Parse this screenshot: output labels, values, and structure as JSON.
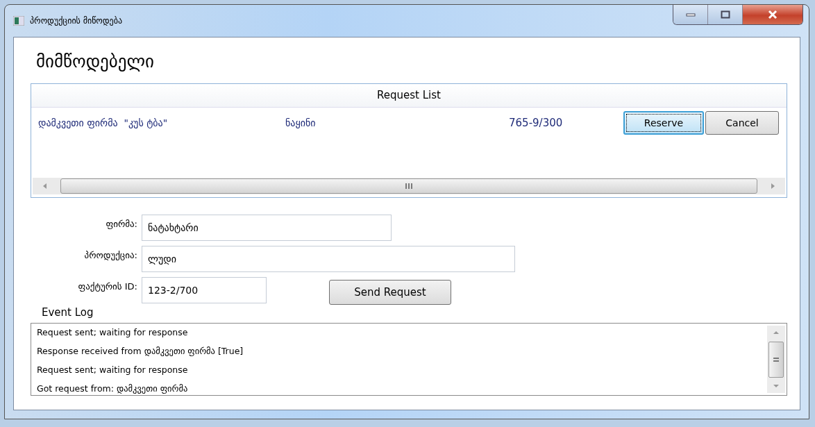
{
  "window": {
    "title": "პროდუქციის მიწოდება"
  },
  "heading": "მიმწოდებელი",
  "request_list": {
    "title": "Request List",
    "rows": [
      {
        "cells": [
          "დამკვეთი ფირმა  \"კუს ტბა\"",
          "ნაყინი",
          "765-9/300"
        ],
        "buttons": [
          {
            "label": "Reserve",
            "focused": true
          },
          {
            "label": "Cancel",
            "focused": false
          }
        ]
      }
    ]
  },
  "form": {
    "fields": [
      {
        "label": "ფირმა:",
        "value": "ნატახტარი"
      },
      {
        "label": "პროდუქცია:",
        "value": "ლუდი"
      },
      {
        "label": "ფაქტურის ID:",
        "value": "123-2/700"
      }
    ],
    "send_button": "Send Request"
  },
  "event_log": {
    "label": "Event Log",
    "lines": [
      "Request sent; waiting for response",
      "Response received from დამკვეთი ფირმა [True]",
      "Request sent; waiting for response",
      "Got request from: დამკვეთი ფირმა"
    ]
  }
}
